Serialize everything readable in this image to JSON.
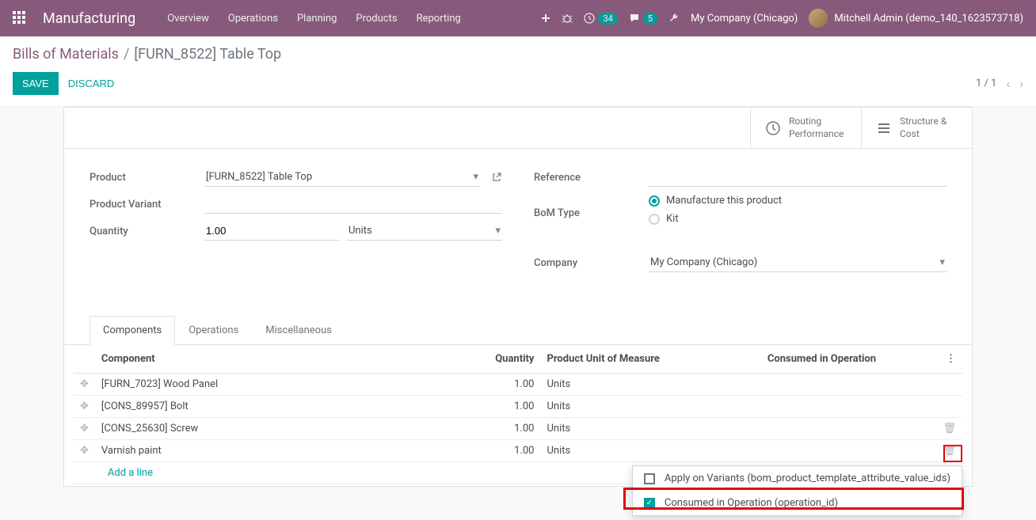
{
  "topnav": {
    "brand": "Manufacturing",
    "items": [
      "Overview",
      "Operations",
      "Planning",
      "Products",
      "Reporting"
    ],
    "badge1": "34",
    "badge2": "5",
    "company": "My Company (Chicago)",
    "user": "Mitchell Admin (demo_140_1623573718)"
  },
  "breadcrumb": {
    "root": "Bills of Materials",
    "current": "[FURN_8522] Table Top"
  },
  "actions": {
    "save": "SAVE",
    "discard": "DISCARD",
    "pager": "1 / 1"
  },
  "statButtons": {
    "routing1": "Routing",
    "routing2": "Performance",
    "structure1": "Structure &",
    "structure2": "Cost"
  },
  "form": {
    "labels": {
      "product": "Product",
      "variant": "Product Variant",
      "quantity": "Quantity",
      "reference": "Reference",
      "bomType": "BoM Type",
      "company": "Company"
    },
    "product": "[FURN_8522] Table Top",
    "quantity": "1.00",
    "unit": "Units",
    "bomOptions": {
      "manufacture": "Manufacture this product",
      "kit": "Kit"
    },
    "company": "My Company (Chicago)"
  },
  "tabs": [
    "Components",
    "Operations",
    "Miscellaneous"
  ],
  "table": {
    "headers": {
      "component": "Component",
      "quantity": "Quantity",
      "uom": "Product Unit of Measure",
      "consumed": "Consumed in Operation"
    },
    "rows": [
      {
        "name": "[FURN_7023] Wood Panel",
        "qty": "1.00",
        "uom": "Units"
      },
      {
        "name": "[CONS_89957] Bolt",
        "qty": "1.00",
        "uom": "Units"
      },
      {
        "name": "[CONS_25630] Screw",
        "qty": "1.00",
        "uom": "Units"
      },
      {
        "name": "Varnish paint",
        "qty": "1.00",
        "uom": "Units"
      }
    ],
    "addLine": "Add a line"
  },
  "colMenu": {
    "opt1": "Apply on Variants (bom_product_template_attribute_value_ids)",
    "opt2": "Consumed in Operation (operation_id)"
  }
}
